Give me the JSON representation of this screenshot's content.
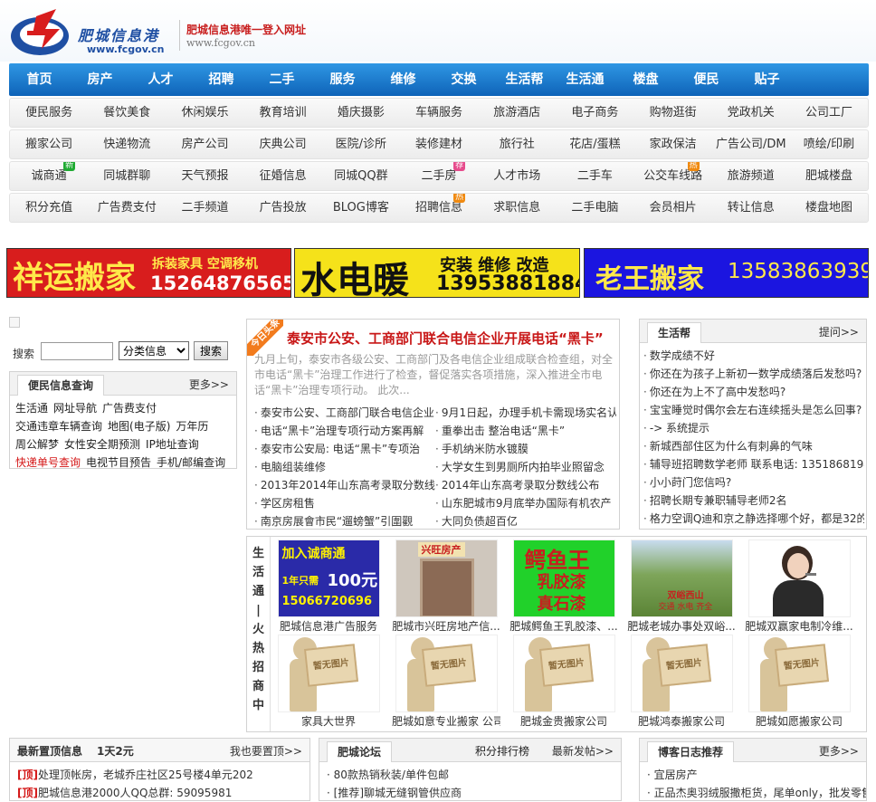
{
  "header": {
    "logo_cn": "肥城信息港",
    "logo_url": "www.fcgov.cn",
    "slogan": "肥城信息港唯一登入网址",
    "site_url": "www.fcgov.cn",
    "colors": {
      "brand_blue": "#1f4fa3",
      "brand_red": "#d81d1d",
      "nav_blue": "#1574cc"
    }
  },
  "nav": [
    "首页",
    "房产",
    "人才",
    "招聘",
    "二手",
    "服务",
    "维修",
    "交换",
    "生活帮",
    "生活通",
    "楼盘",
    "便民",
    "贴子"
  ],
  "subnav": [
    [
      {
        "t": "便民服务"
      },
      {
        "t": "餐饮美食"
      },
      {
        "t": "休闲娱乐"
      },
      {
        "t": "教育培训"
      },
      {
        "t": "婚庆摄影"
      },
      {
        "t": "车辆服务"
      },
      {
        "t": "旅游酒店"
      },
      {
        "t": "电子商务"
      },
      {
        "t": "购物逛街"
      },
      {
        "t": "党政机关"
      },
      {
        "t": "公司工厂"
      }
    ],
    [
      {
        "t": "搬家公司"
      },
      {
        "t": "快递物流"
      },
      {
        "t": "房产公司"
      },
      {
        "t": "庆典公司"
      },
      {
        "t": "医院/诊所"
      },
      {
        "t": "装修建材"
      },
      {
        "t": "旅行社"
      },
      {
        "t": "花店/蛋糕"
      },
      {
        "t": "家政保洁"
      },
      {
        "t": "广告公司/DM"
      },
      {
        "t": "喷绘/印刷"
      }
    ],
    [
      {
        "t": "诚商通",
        "badge": "新"
      },
      {
        "t": "同城群聊"
      },
      {
        "t": "天气预报"
      },
      {
        "t": "征婚信息"
      },
      {
        "t": "同城QQ群"
      },
      {
        "t": "二手房",
        "badge": "荐"
      },
      {
        "t": "人才市场"
      },
      {
        "t": "二手车"
      },
      {
        "t": "公交车线路",
        "badge": "热"
      },
      {
        "t": "旅游频道"
      },
      {
        "t": "肥城楼盘"
      }
    ],
    [
      {
        "t": "积分充值"
      },
      {
        "t": "广告费支付"
      },
      {
        "t": "二手频道"
      },
      {
        "t": "广告投放"
      },
      {
        "t": "BLOG博客"
      },
      {
        "t": "招聘信息",
        "badge": "热"
      },
      {
        "t": "求职信息"
      },
      {
        "t": "二手电脑"
      },
      {
        "t": "会员相片"
      },
      {
        "t": "转让信息"
      },
      {
        "t": "楼盘地图"
      }
    ]
  ],
  "banners": {
    "b1": {
      "title": "祥运搬家",
      "sub": "拆装家具 空调移机",
      "phone": "15264876565"
    },
    "b2": {
      "title": "水电暖",
      "sub": "安装 维修 改造",
      "phone": "13953881884"
    },
    "b3": {
      "title": "老王搬家",
      "phone": "13583863939"
    }
  },
  "search": {
    "label": "搜索",
    "value": "",
    "select": "分类信息",
    "button": "搜索"
  },
  "query": {
    "title": "便民信息查询",
    "more": "更多>>",
    "rows": [
      [
        "生活通",
        "网址导航",
        "广告费支付"
      ],
      [
        "交通违章车辆查询",
        "地图(电子版)",
        "万年历"
      ],
      [
        "周公解梦",
        "女性安全期预测",
        "IP地址查询"
      ],
      [
        "快递单号查询",
        "电视节目预告",
        "手机/邮编查询"
      ]
    ]
  },
  "headline": {
    "ribbon": "今日头条",
    "title": "泰安市公安、工商部门联合电信企业开展电话“黑卡”",
    "summary": "九月上旬，泰安市各级公安、工商部门及各电信企业组成联合检查组，对全市电话“黑卡”治理工作进行了检查，督促落实各项措施，深入推进全市电话“黑卡”治理专项行动。  此次...",
    "items": [
      [
        "泰安市公安、工商部门联合电信企业",
        "9月1日起，办理手机卡需现场实名认"
      ],
      [
        "电话“黑卡”治理专项行动方案再解",
        "重拳出击 整治电话“黑卡”"
      ],
      [
        "泰安市公安局: 电话“黑卡”专项治",
        "手机纳米防水镀膜"
      ],
      [
        "电脑组装维修",
        "大学女生到男厕所内拍毕业照留念"
      ],
      [
        "2013年2014年山东高考录取分数线",
        "2014年山东高考录取分数线公布"
      ],
      [
        "学区房租售",
        "山东肥城市9月底举办国际有机农产"
      ],
      [
        "南京房展會市民“遛螃蟹”引圍觀",
        "大同负债超百亿"
      ]
    ]
  },
  "help": {
    "title": "生活帮",
    "more": "提问>>",
    "items": [
      "数学成绩不好",
      "你还在为孩子上新初一数学成绩落后发愁吗?",
      "你还在为上不了高中发愁吗?",
      "宝宝睡觉时偶尔会左右连续摇头是怎么回事?",
      "-> 系统提示",
      "新城西部住区为什么有刺鼻的气味",
      "辅导班招聘数学老师 联系电话: 13518681944",
      "小小莳门您信吗?",
      "招聘长期专兼职辅导老师2名",
      "格力空调Q迪和京之静选择哪个好，都是32的"
    ]
  },
  "ads": {
    "vertical": "生活通|火热招商中",
    "row1": [
      {
        "cap": "肥城信息港广告服务",
        "kind": "chengshang",
        "l1": "加入诚商通",
        "l2": "1年只需",
        "l3": "100元",
        "l4": "15066720696"
      },
      {
        "cap": "肥城市兴旺房地产信...",
        "kind": "house",
        "l1": "兴旺房产"
      },
      {
        "cap": "肥城鳄鱼王乳胶漆、...",
        "kind": "croc",
        "l1": "鳄鱼王",
        "l2": "乳胶漆",
        "l3": "真石漆"
      },
      {
        "cap": "肥城老城办事处双峪...",
        "kind": "mountain",
        "l1": "双峪西山",
        "l2": "交通 水电 齐全"
      },
      {
        "cap": "肥城双赢家电制冷维...",
        "kind": "service"
      }
    ],
    "row2": [
      {
        "cap": "家具大世界",
        "ph": "暂无图片"
      },
      {
        "cap": "肥城如意专业搬家 公司",
        "ph": "暂无图片"
      },
      {
        "cap": "肥城金贵搬家公司",
        "ph": "暂无图片"
      },
      {
        "cap": "肥城鸿泰搬家公司",
        "ph": "暂无图片"
      },
      {
        "cap": "肥城如愿搬家公司",
        "ph": "暂无图片"
      }
    ]
  },
  "bottom": {
    "b1": {
      "title": "最新置顶信息",
      "note": "1天2元",
      "more": "我也要置顶>>",
      "items": [
        {
          "tag": "[顶]",
          "t": "处理顶帐房，老城乔庄社区25号楼4单元202"
        },
        {
          "tag": "[顶]",
          "t": "肥城信息港2000人QQ总群: 59095981"
        }
      ]
    },
    "b2": {
      "title": "肥城论坛",
      "rank": "积分排行榜",
      "more": "最新发帖>>",
      "items": [
        "80款热销秋装/单件包邮",
        "[推荐]聊城无缝钢管供应商"
      ]
    },
    "b3": {
      "title": "博客日志推荐",
      "more": "更多>>",
      "items": [
        "宜居房产",
        "正品杰奥羽绒服撒柜货，尾单only，批发零售"
      ]
    }
  }
}
